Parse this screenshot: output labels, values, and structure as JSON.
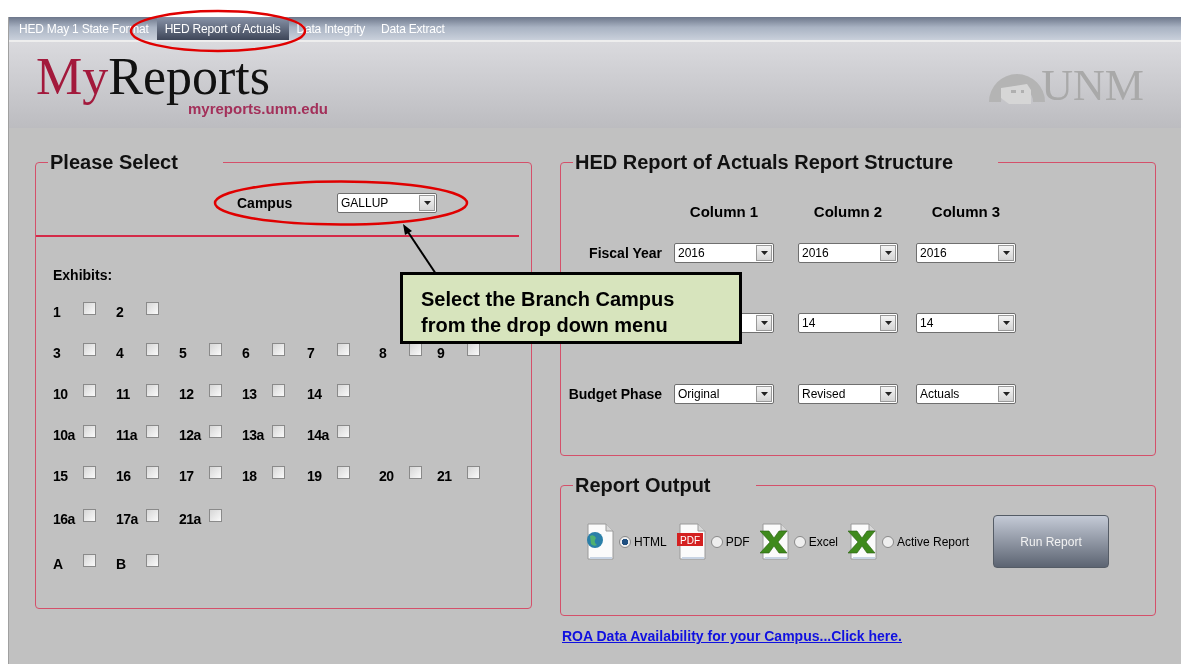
{
  "tabs": [
    {
      "label": "HED May 1 State Format",
      "selected": false
    },
    {
      "label": "HED Report of Actuals",
      "selected": true
    },
    {
      "label": "Data Integrity",
      "selected": false
    },
    {
      "label": "Data Extract",
      "selected": false
    }
  ],
  "header": {
    "logo_first": "My",
    "logo_second": "Reports",
    "url": "myreports.unm.edu",
    "org_logo": "UNM"
  },
  "select_panel": {
    "title": "Please Select",
    "campus": {
      "label": "Campus",
      "value": "GALLUP"
    },
    "exhibits_label": "Exhibits:",
    "exhibits": [
      [
        {
          "label": "1",
          "checked": false
        },
        {
          "label": "2",
          "checked": false
        }
      ],
      [
        {
          "label": "3",
          "checked": false
        },
        {
          "label": "4",
          "checked": false
        },
        {
          "label": "5",
          "checked": false
        },
        {
          "label": "6",
          "checked": false
        },
        {
          "label": "7",
          "checked": false
        },
        {
          "label": "8",
          "checked": false
        },
        {
          "label": "9",
          "checked": false
        }
      ],
      [
        {
          "label": "10",
          "checked": false
        },
        {
          "label": "11",
          "checked": false
        },
        {
          "label": "12",
          "checked": false
        },
        {
          "label": "13",
          "checked": false
        },
        {
          "label": "14",
          "checked": false
        }
      ],
      [
        {
          "label": "10a",
          "checked": false
        },
        {
          "label": "11a",
          "checked": false
        },
        {
          "label": "12a",
          "checked": false
        },
        {
          "label": "13a",
          "checked": false
        },
        {
          "label": "14a",
          "checked": false
        }
      ],
      [
        {
          "label": "15",
          "checked": false
        },
        {
          "label": "16",
          "checked": false
        },
        {
          "label": "17",
          "checked": false
        },
        {
          "label": "18",
          "checked": false
        },
        {
          "label": "19",
          "checked": false
        },
        {
          "label": "20",
          "checked": false
        },
        {
          "label": "21",
          "checked": false
        }
      ],
      [
        {
          "label": "16a",
          "checked": false
        },
        {
          "label": "17a",
          "checked": false
        },
        {
          "label": "21a",
          "checked": false
        }
      ],
      [
        {
          "label": "A",
          "checked": false
        },
        {
          "label": "B",
          "checked": false
        }
      ]
    ]
  },
  "structure_panel": {
    "title": "HED Report of Actuals Report Structure",
    "columns": [
      "Column 1",
      "Column 2",
      "Column 3"
    ],
    "rows": [
      {
        "label": "Fiscal Year",
        "cells": [
          {
            "kind": "value",
            "value": "2016"
          },
          {
            "kind": "value",
            "value": "2016"
          },
          {
            "kind": "value",
            "value": "2016"
          }
        ]
      },
      {
        "cells": [
          {
            "kind": "covered"
          },
          {
            "kind": "value",
            "value": "14"
          },
          {
            "kind": "value",
            "value": "14"
          }
        ]
      },
      {
        "label": "Budget Phase",
        "cells": [
          {
            "kind": "value",
            "value": "Original"
          },
          {
            "kind": "value",
            "value": "Revised"
          },
          {
            "kind": "value",
            "value": "Actuals"
          }
        ]
      }
    ]
  },
  "output_panel": {
    "title": "Report Output",
    "formats": [
      {
        "kind": "html",
        "label": "HTML",
        "selected": true
      },
      {
        "kind": "pdf",
        "label": "PDF",
        "icon_text": "PDF",
        "selected": false
      },
      {
        "kind": "excel",
        "label": "Excel",
        "selected": false
      },
      {
        "kind": "active",
        "label": "Active Report",
        "selected": false
      }
    ],
    "run_button": "Run Report"
  },
  "link": "ROA Data Availability for your Campus...Click here.",
  "callout": {
    "lines": [
      "Select the Branch Campus",
      "from the drop down menu"
    ]
  }
}
